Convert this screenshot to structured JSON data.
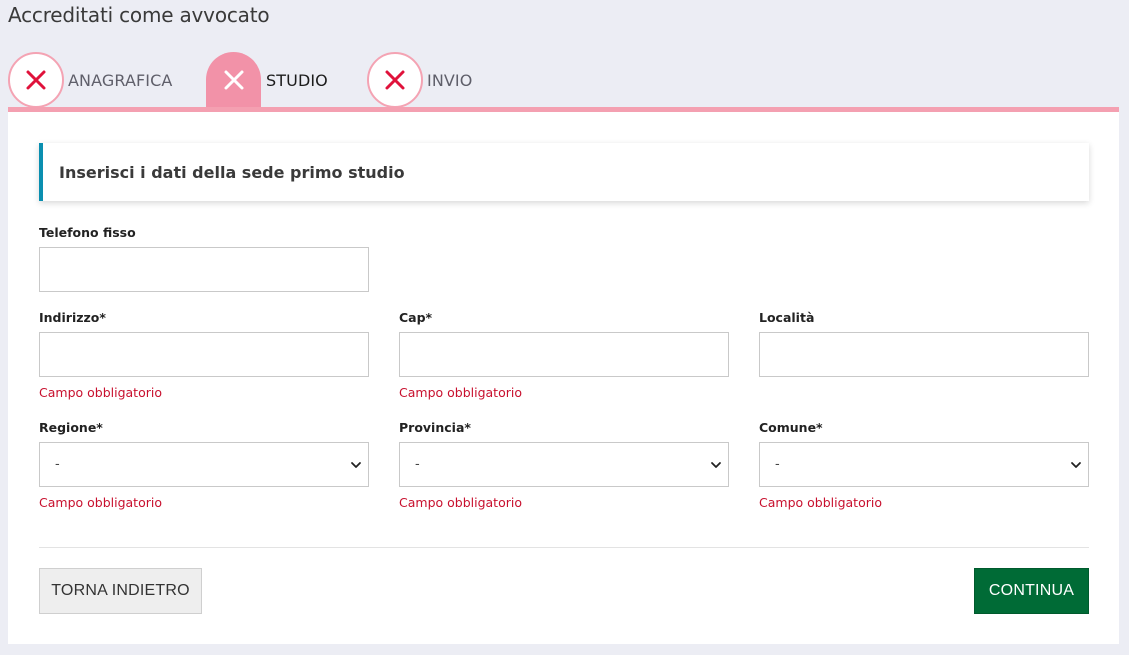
{
  "page": {
    "title": "Accreditati come avvocato"
  },
  "stepper": {
    "steps": [
      {
        "label": "ANAGRAFICA",
        "status_icon": "close-icon",
        "state": "error"
      },
      {
        "label": "STUDIO",
        "status_icon": "close-icon",
        "state": "active"
      },
      {
        "label": "INVIO",
        "status_icon": "close-icon",
        "state": "error"
      }
    ]
  },
  "alert": {
    "text": "Inserisci i dati della sede primo studio"
  },
  "form": {
    "telefono": {
      "label": "Telefono fisso",
      "value": ""
    },
    "indirizzo": {
      "label": "Indirizzo*",
      "value": "",
      "error": "Campo obbligatorio"
    },
    "cap": {
      "label": "Cap*",
      "value": "",
      "error": "Campo obbligatorio"
    },
    "localita": {
      "label": "Località",
      "value": ""
    },
    "regione": {
      "label": "Regione*",
      "selected": "-",
      "error": "Campo obbligatorio"
    },
    "provincia": {
      "label": "Provincia*",
      "selected": "-",
      "error": "Campo obbligatorio"
    },
    "comune": {
      "label": "Comune*",
      "selected": "-",
      "error": "Campo obbligatorio"
    }
  },
  "buttons": {
    "back": "TORNA INDIETRO",
    "continue": "CONTINUA"
  },
  "colors": {
    "step_accent": "#f292a8",
    "step_icon": "#e0123b",
    "alert_border": "#0a8fb0",
    "error": "#c8102e",
    "primary_button": "#006b36",
    "background": "#ecedf4"
  }
}
